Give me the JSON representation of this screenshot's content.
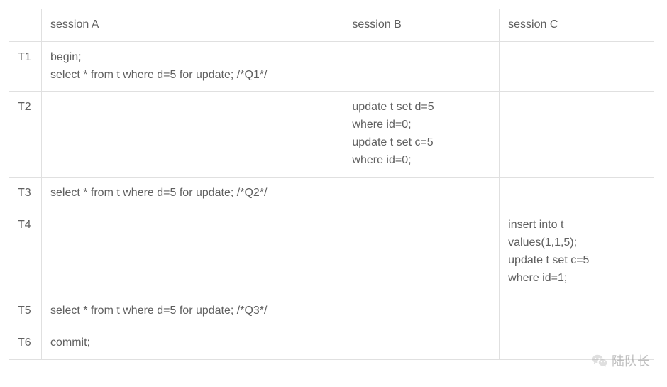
{
  "table": {
    "headers": [
      "",
      "session A",
      "session B",
      "session C"
    ],
    "rows": [
      {
        "time": "T1",
        "a": [
          "begin;",
          "select * from t where d=5 for update; /*Q1*/"
        ],
        "b": [],
        "c": []
      },
      {
        "time": "T2",
        "a": [],
        "b": [
          "update t set d=5",
          "where id=0;",
          "update t set c=5",
          "where id=0;"
        ],
        "c": []
      },
      {
        "time": "T3",
        "a": [
          "select * from t where d=5 for update; /*Q2*/"
        ],
        "b": [],
        "c": []
      },
      {
        "time": "T4",
        "a": [],
        "b": [],
        "c": [
          "insert into t",
          "values(1,1,5);",
          "update t set c=5",
          "where id=1;"
        ]
      },
      {
        "time": "T5",
        "a": [
          "select * from t where d=5 for update; /*Q3*/"
        ],
        "b": [],
        "c": []
      },
      {
        "time": "T6",
        "a": [
          "commit;"
        ],
        "b": [],
        "c": []
      }
    ]
  },
  "watermark": {
    "text": "陆队长"
  }
}
